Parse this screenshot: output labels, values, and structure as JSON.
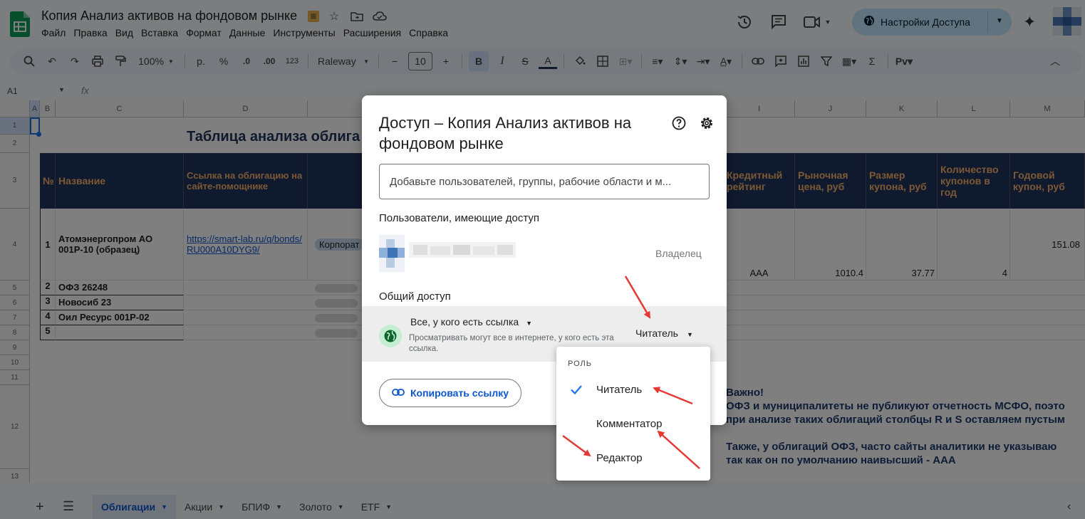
{
  "document": {
    "title": "Копия Анализ активов на фондовом рынке"
  },
  "menu": [
    "Файл",
    "Правка",
    "Вид",
    "Вставка",
    "Формат",
    "Данные",
    "Инструменты",
    "Расширения",
    "Справка"
  ],
  "header": {
    "share_label": "Настройки Доступа"
  },
  "toolbar": {
    "zoom": "100%",
    "currency": "р.",
    "percent": "%",
    "dec_decrease": ".0",
    "dec_increase": ".00",
    "format_123": "123",
    "font": "Raleway",
    "font_size": "10",
    "bold": "B",
    "italic": "I",
    "strike": "S",
    "text_color": "A",
    "insert_fn": "Σ"
  },
  "formula_bar": {
    "cell_ref": "A1",
    "fx": "fx"
  },
  "grid": {
    "columns": [
      "A",
      "B",
      "C",
      "D",
      "I",
      "J",
      "K",
      "L",
      "M"
    ],
    "rows": [
      "1",
      "2",
      "3",
      "4",
      "5",
      "6",
      "7",
      "8",
      "9",
      "10",
      "11",
      "12",
      "13"
    ],
    "sheet_title": "Таблица анализа облига",
    "headers": {
      "num": "№",
      "name": "Название",
      "link": "Ссылка на облигацию на сайте-помощнике",
      "rating": "Кредитный рейтинг",
      "price": "Рыночная цена, руб",
      "coupon_size": "Размер купона, руб",
      "coupon_count": "Количество купонов в год",
      "annual_coupon": "Годовой купон, руб"
    },
    "rows_data": [
      {
        "num": "1",
        "name": "Атомэнергопром АО 001Р-10 (образец)",
        "link": "https://smart-lab.ru/q/bonds/RU000A10DYG9/",
        "type": "Корпорат",
        "rating": "AAA",
        "price": "1010.4",
        "coupon_size": "37.77",
        "coupon_count": "4",
        "annual_coupon": "151.08"
      },
      {
        "num": "2",
        "name": "ОФЗ 26248"
      },
      {
        "num": "3",
        "name": "Новосиб 23"
      },
      {
        "num": "4",
        "name": "Оил Ресурс 001Р-02"
      },
      {
        "num": "5",
        "name": ""
      }
    ],
    "note": [
      "Важно!",
      "ОФЗ и муниципалитеты не публикуют отчетность МСФО, поэто",
      "при анализе таких облигаций столбцы R и S оставляем пустым",
      "",
      "Также, у облигаций ОФЗ, часто сайты аналитики не указываю",
      "так как он по умолчанию наивысший - AAA"
    ]
  },
  "sheet_tabs": [
    {
      "label": "Облигации",
      "active": true
    },
    {
      "label": "Акции",
      "active": false
    },
    {
      "label": "БПИФ",
      "active": false
    },
    {
      "label": "Золото",
      "active": false
    },
    {
      "label": "ETF",
      "active": false
    }
  ],
  "dialog": {
    "title": "Доступ – Копия Анализ активов на фондовом рынке",
    "add_placeholder": "Добавьте пользователей, группы, рабочие области и м...",
    "users_label": "Пользователи, имеющие доступ",
    "owner_role": "Владелец",
    "general_access_label": "Общий доступ",
    "scope": "Все, у кого есть ссылка",
    "scope_desc": "Просматривать могут все в интернете, у кого есть эта ссылка.",
    "current_role": "Читатель",
    "copy_link": "Копировать ссылку"
  },
  "role_menu": {
    "label": "РОЛЬ",
    "items": [
      {
        "label": "Читатель",
        "selected": true
      },
      {
        "label": "Комментатор",
        "selected": false
      },
      {
        "label": "Редактор",
        "selected": false
      }
    ]
  },
  "colors": {
    "accent": "#0b57d0",
    "header_bg": "#21345c",
    "header_text": "#f6b26b",
    "arrow": "#e53935",
    "share_bg": "#c2e7ff"
  }
}
